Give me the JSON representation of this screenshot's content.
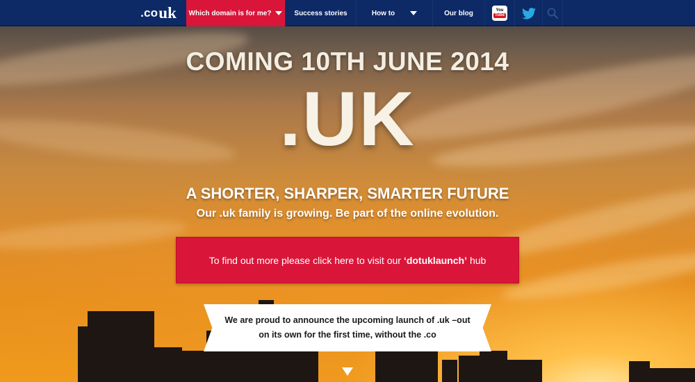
{
  "nav": {
    "logo_co": ".co",
    "logo_uk": "uk",
    "which_domain": "Which domain is for me?",
    "success_stories": "Success stories",
    "how_to": "How to",
    "blog": "Our blog",
    "youtube_top": "You",
    "youtube_bottom": "Tube",
    "icons": [
      "youtube-icon",
      "twitter-icon",
      "search-icon"
    ]
  },
  "hero": {
    "coming": "COMING 10TH JUNE 2014",
    "domain": ".UK",
    "tagline": "A SHORTER, SHARPER, SMARTER FUTURE",
    "subline": "Our .uk family is growing. Be part of the online evolution."
  },
  "cta": {
    "prefix": "To find out more please click here to visit our",
    "highlight": "‘dotuklaunch’",
    "suffix": "hub"
  },
  "ribbon": {
    "text": "We are proud to announce the upcoming launch of .uk –out on its own for the first time, without the .co"
  },
  "colors": {
    "nav_background": "#0d2a66",
    "accent_red": "#d9163a",
    "twitter_blue": "#29a9e1"
  }
}
